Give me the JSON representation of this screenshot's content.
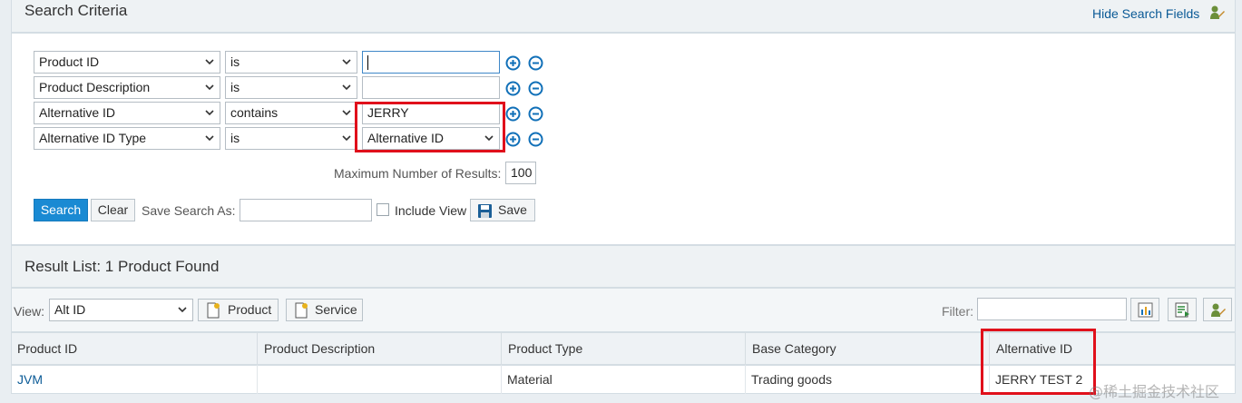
{
  "search": {
    "title": "Search Criteria",
    "hide_link": "Hide Search Fields",
    "rows": [
      {
        "field": "Product ID",
        "operator": "is",
        "value": ""
      },
      {
        "field": "Product Description",
        "operator": "is",
        "value": ""
      },
      {
        "field": "Alternative ID",
        "operator": "contains",
        "value": "JERRY"
      },
      {
        "field": "Alternative ID Type",
        "operator": "is",
        "value": "Alternative ID"
      }
    ],
    "max_results_label": "Maximum Number of Results:",
    "max_results_value": "100",
    "search_button": "Search",
    "clear_button": "Clear",
    "save_as_label": "Save Search As:",
    "save_as_value": "",
    "include_view_label": "Include View",
    "save_button": "Save"
  },
  "results": {
    "title": "Result List: 1 Product Found",
    "view_label": "View:",
    "view_value": "Alt ID",
    "product_button": "Product",
    "service_button": "Service",
    "filter_label": "Filter:",
    "filter_value": "",
    "columns": [
      "Product ID",
      "Product Description",
      "Product Type",
      "Base Category",
      "Alternative ID"
    ],
    "rows": [
      {
        "product_id": "JVM",
        "description": "",
        "type": "Material",
        "category": "Trading goods",
        "alt_id": "JERRY TEST 2"
      }
    ]
  },
  "watermark": "@稀土掘金技术社区",
  "colors": {
    "link": "#0a5a96",
    "primary": "#1a8ad3",
    "highlight": "#e0101b",
    "plus_minus": "#1170b8"
  },
  "icons": [
    "chevron-down-icon",
    "add-row-icon",
    "remove-row-icon",
    "save-disk-icon",
    "new-document-icon",
    "chart-icon",
    "export-icon",
    "personalize-icon"
  ]
}
